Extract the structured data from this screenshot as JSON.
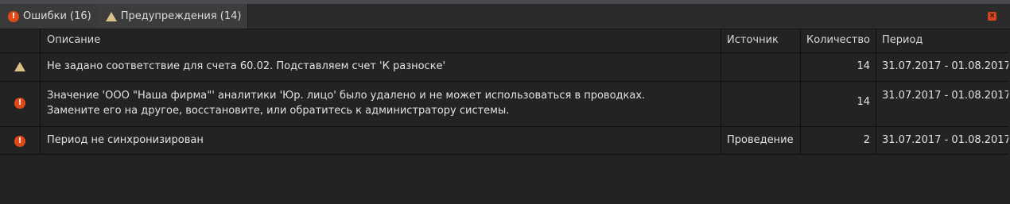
{
  "tabs": {
    "errors": {
      "label": "Ошибки (16)",
      "icon": "error-icon"
    },
    "warnings": {
      "label": "Предупреждения (14)",
      "icon": "warning-icon"
    }
  },
  "close": {
    "glyph": "×"
  },
  "columns": {
    "description": "Описание",
    "source": "Источник",
    "count": "Количество",
    "period": "Период"
  },
  "rows": [
    {
      "type": "warning",
      "description": [
        "Не задано соответствие для счета 60.02. Подставляем счет 'К разноске'"
      ],
      "source": "",
      "count": "14",
      "period": "31.07.2017 - 01.08.2017"
    },
    {
      "type": "error",
      "description": [
        "Значение 'ООО \"Наша фирма\"' аналитики 'Юр. лицо' было удалено и не может использоваться в проводках.",
        "Замените его на другое, восстановите, или обратитесь к администратору системы."
      ],
      "source": "",
      "count": "14",
      "period": "31.07.2017 - 01.08.2017"
    },
    {
      "type": "error",
      "description": [
        "Период не синхронизирован"
      ],
      "source": "Проведение",
      "count": "2",
      "period": "31.07.2017 - 01.08.2017"
    }
  ],
  "colors": {
    "error": "#dc4a18",
    "warning": "#d9c089",
    "background": "#232323"
  }
}
